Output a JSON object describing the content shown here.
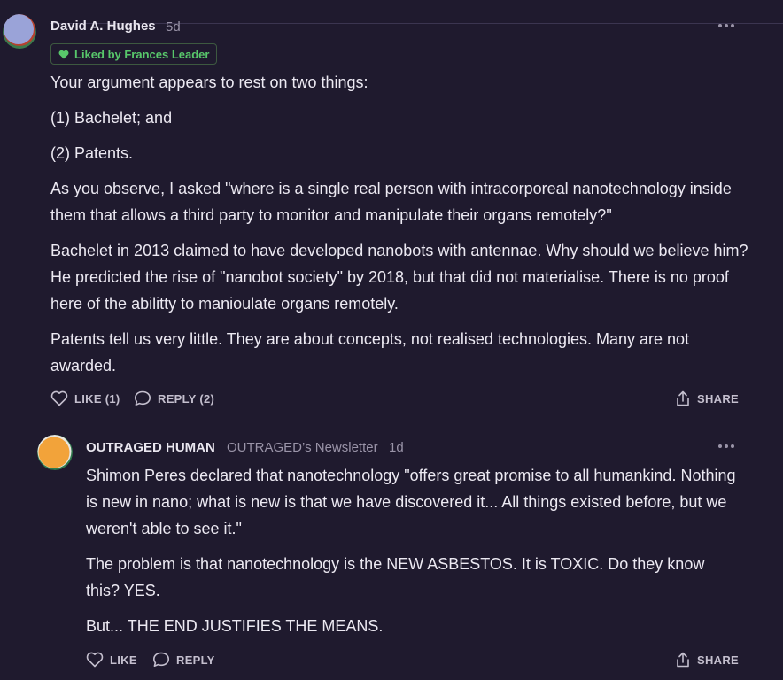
{
  "comment1": {
    "author": "David A. Hughes",
    "age": "5d",
    "liked_by": "Liked by Frances Leader",
    "paragraphs": [
      "Your argument appears to rest on two things:",
      "(1) Bachelet; and",
      "(2) Patents.",
      "As you observe, I asked \"where is a single real person with intracorporeal nanotechnology inside them that allows a third party to monitor and manipulate their organs remotely?\"",
      "Bachelet in 2013 claimed to have developed nanobots with antennae. Why should we believe him? He predicted the rise of \"nanobot society\" by 2018, but that did not materialise. There is no proof here of the abilitty to manioulate organs remotely.",
      "Patents tell us very little. They are about concepts, not realised technologies. Many are not awarded."
    ],
    "actions": {
      "like": "LIKE (1)",
      "reply": "REPLY (2)",
      "share": "SHARE"
    }
  },
  "comment2": {
    "author": "OUTRAGED HUMAN",
    "newsletter": "OUTRAGED’s Newsletter",
    "age": "1d",
    "paragraphs": [
      "Shimon Peres declared that nanotechnology \"offers great promise to all humankind. Nothing is new in nano; what is new is that we have discovered it... All things existed before, but we weren't able to see it.\"",
      "The problem is that nanotechnology is the NEW ASBESTOS. It is TOXIC. Do they know this? YES.",
      "But... THE END JUSTIFIES THE MEANS."
    ],
    "actions": {
      "like": "LIKE",
      "reply": "REPLY",
      "share": "SHARE"
    }
  },
  "icons": {
    "like": "heart-outline-icon",
    "reply": "speech-bubble-icon",
    "share": "share-upload-icon",
    "more": "ellipsis-icon",
    "liked": "heart-filled-icon"
  },
  "colors": {
    "background": "#1f1a2e",
    "text": "#ece9f2",
    "muted": "#9a94a8",
    "liked_green": "#58c76b"
  }
}
